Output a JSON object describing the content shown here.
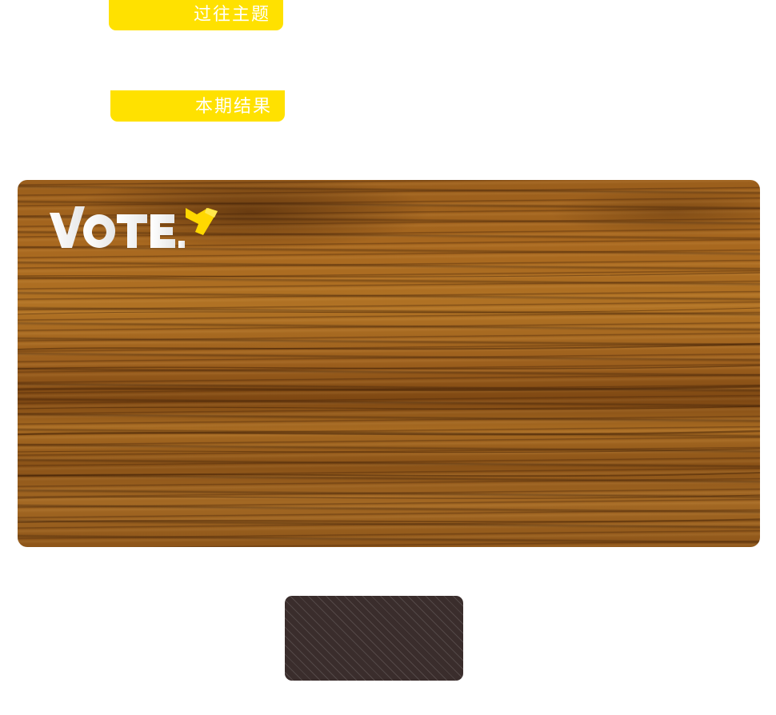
{
  "tabs": {
    "past_topics_label": "过往主题",
    "current_results_label": "本期结果"
  },
  "logo": {
    "text": "VOTE.",
    "accent_color": "#ffd800"
  },
  "colors": {
    "tab_background": "#ffe100",
    "tab_text": "#ffffff",
    "card_background": "#3a2d2c"
  }
}
